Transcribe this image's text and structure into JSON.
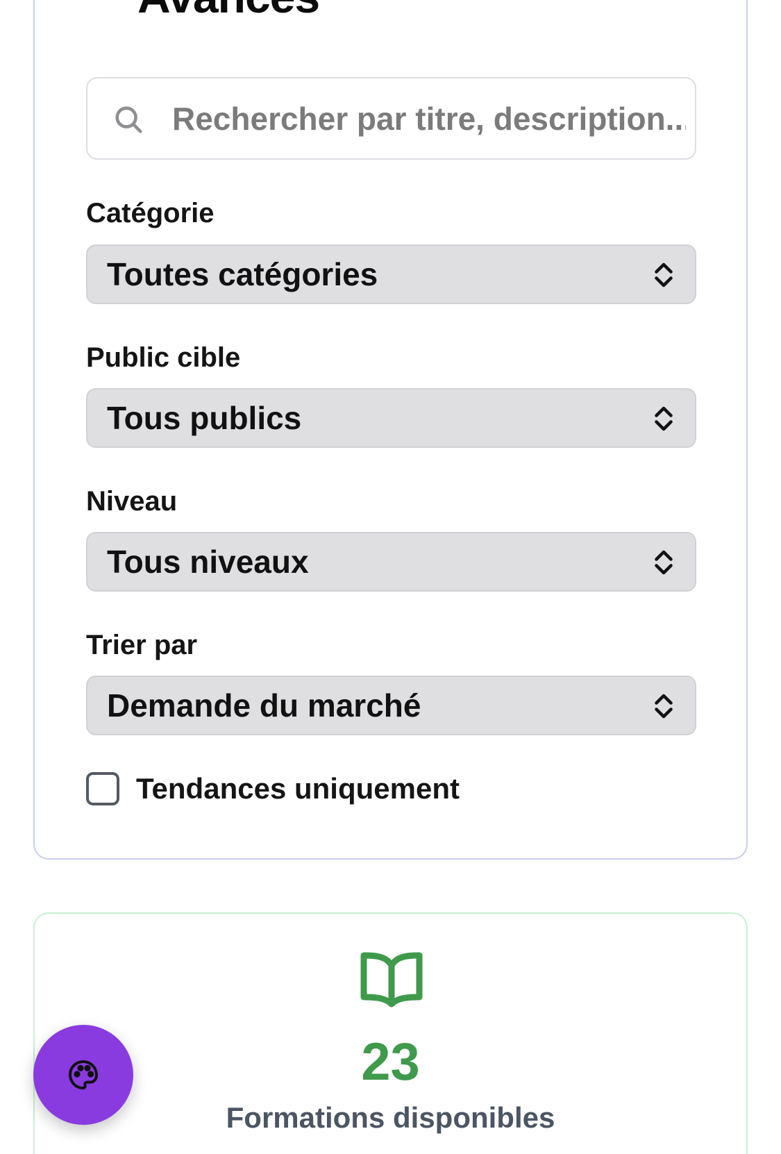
{
  "filters": {
    "title": "Avancés",
    "search": {
      "placeholder": "Rechercher par titre, description..."
    },
    "category": {
      "label": "Catégorie",
      "selected": "Toutes catégories"
    },
    "audience": {
      "label": "Public cible",
      "selected": "Tous publics"
    },
    "level": {
      "label": "Niveau",
      "selected": "Tous niveaux"
    },
    "sort": {
      "label": "Trier par",
      "selected": "Demande du marché"
    },
    "trending": {
      "label": "Tendances uniquement",
      "checked": false
    }
  },
  "stats": {
    "icon": "book-open-icon",
    "count": "23",
    "label": "Formations disponibles"
  },
  "fab": {
    "icon": "palette-icon"
  },
  "colors": {
    "accent_purple": "#8a3be0",
    "stats_green": "#3f9a4b",
    "filters_border": "#c9cdf2",
    "stats_border": "#c6f0d2"
  }
}
